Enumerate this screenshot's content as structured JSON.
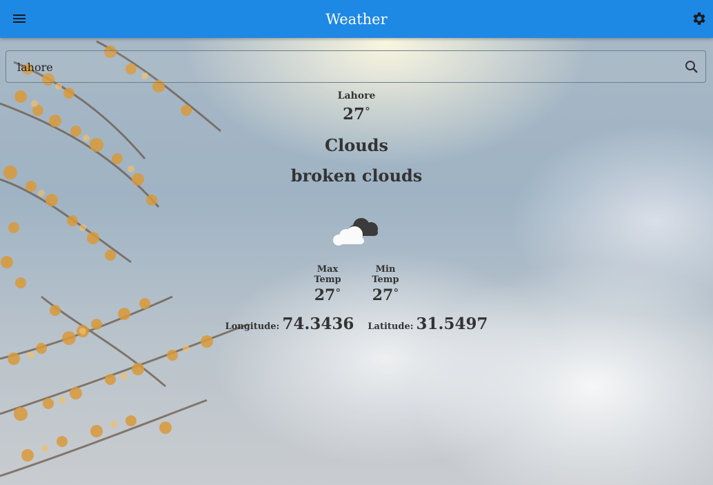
{
  "appbar": {
    "title": "Weather",
    "menu_icon": "menu-icon",
    "settings_icon": "settings-icon"
  },
  "search": {
    "value": "lahore",
    "icon": "search-icon"
  },
  "weather": {
    "city": "Lahore",
    "temp": "27",
    "degree_symbol": "°",
    "main": "Clouds",
    "description": "broken clouds",
    "icon": "broken-clouds-icon"
  },
  "minmax": {
    "max_label": "Max Temp",
    "max_value": "27",
    "min_label": "Min Temp",
    "min_value": "27"
  },
  "coords": {
    "lon_label": "Longitude:",
    "lon_value": "74.3436",
    "lat_label": "Latitude:",
    "lat_value": "31.5497"
  },
  "colors": {
    "appbar": "#1e88e5",
    "text": "#333333"
  }
}
